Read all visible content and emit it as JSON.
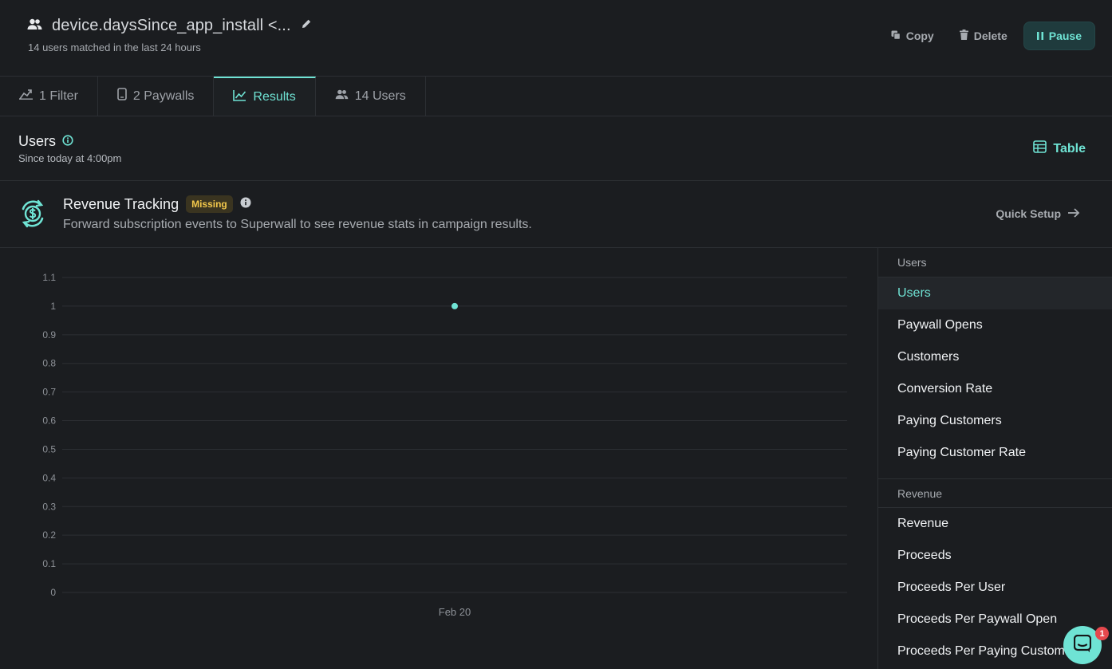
{
  "header": {
    "title": "device.daysSince_app_install <...",
    "subtitle": "14 users matched in the last 24 hours",
    "copy_label": "Copy",
    "delete_label": "Delete",
    "pause_label": "Pause"
  },
  "tabs": [
    {
      "label": "1 Filter",
      "icon": "filter-icon"
    },
    {
      "label": "2 Paywalls",
      "icon": "phone-icon"
    },
    {
      "label": "Results",
      "icon": "chart-line-icon",
      "active": true
    },
    {
      "label": "14 Users",
      "icon": "users-icon"
    }
  ],
  "section": {
    "title": "Users",
    "subtitle": "Since today at 4:00pm",
    "table_label": "Table"
  },
  "revenue": {
    "title": "Revenue Tracking",
    "badge": "Missing",
    "description": "Forward subscription events to Superwall to see revenue stats in campaign results.",
    "quick_setup": "Quick Setup"
  },
  "chart_data": {
    "type": "scatter",
    "x": [
      "Feb 20"
    ],
    "values": [
      1
    ],
    "xlabel": "",
    "ylabel": "",
    "ylim": [
      0,
      1.1
    ],
    "yticks": [
      "0",
      "0.1",
      "0.2",
      "0.3",
      "0.4",
      "0.5",
      "0.6",
      "0.7",
      "0.8",
      "0.9",
      "1",
      "1.1"
    ],
    "grid": true,
    "color": "#6fe3d4"
  },
  "sidebar": {
    "groups": [
      {
        "label": "Users",
        "items": [
          "Users",
          "Paywall Opens",
          "Customers",
          "Conversion Rate",
          "Paying Customers",
          "Paying Customer Rate"
        ]
      },
      {
        "label": "Revenue",
        "items": [
          "Revenue",
          "Proceeds",
          "Proceeds Per User",
          "Proceeds Per Paywall Open",
          "Proceeds Per Paying Customer"
        ]
      }
    ],
    "active": "Users"
  },
  "chat": {
    "badge": "1"
  },
  "colors": {
    "accent": "#6fe3d4",
    "background": "#1b1d20",
    "badge_bg": "#3a3420",
    "badge_text": "#f3c84b"
  }
}
